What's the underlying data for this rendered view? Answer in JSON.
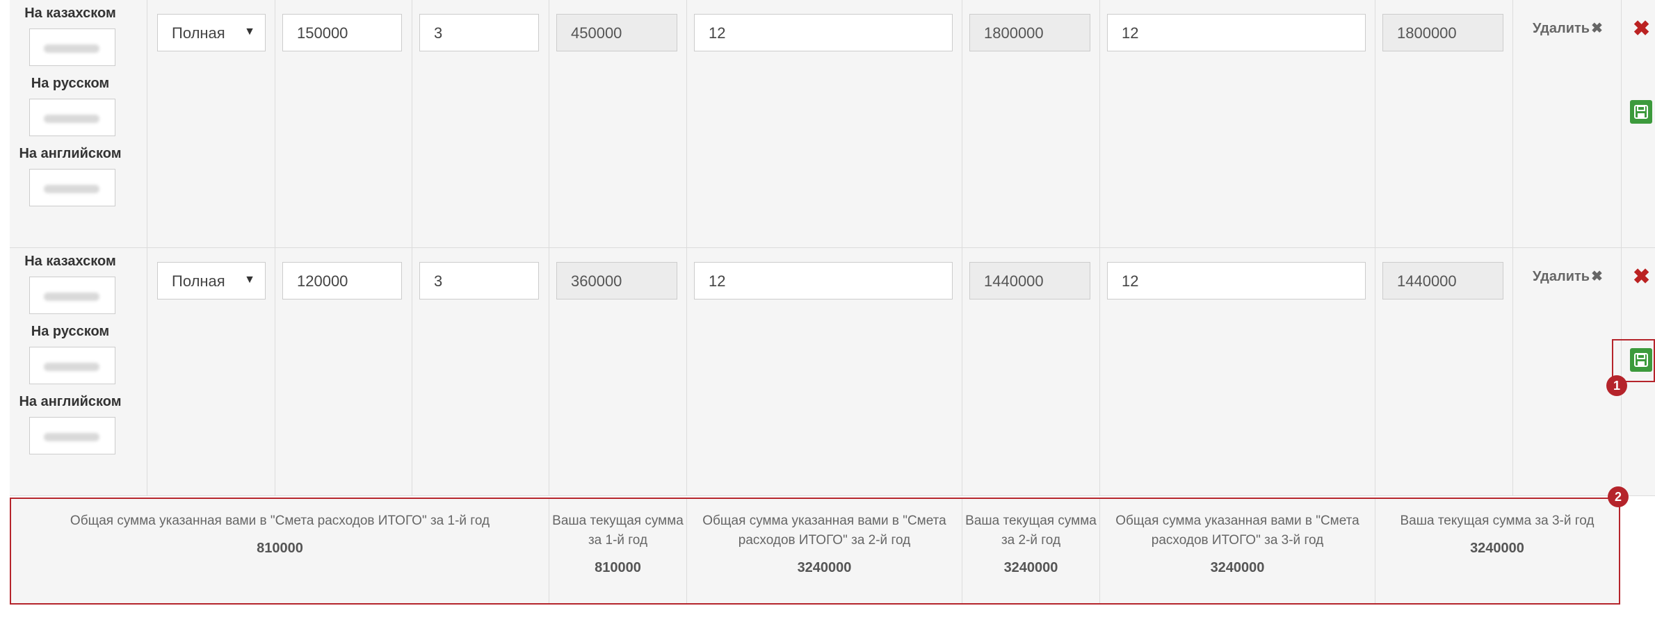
{
  "rows": [
    {
      "langs": [
        "На казахском",
        "На русском",
        "На английском"
      ],
      "type": "Полная",
      "price": "150000",
      "qty": "3",
      "total1": "450000",
      "months2": "12",
      "total2": "1800000",
      "months3": "12",
      "total3": "1800000",
      "delete_label": "Удалить",
      "delete_x": "✖"
    },
    {
      "langs": [
        "На казахском",
        "На русском",
        "На английском"
      ],
      "type": "Полная",
      "price": "120000",
      "qty": "3",
      "total1": "360000",
      "months2": "12",
      "total2": "1440000",
      "months3": "12",
      "total3": "1440000",
      "delete_label": "Удалить",
      "delete_x": "✖"
    }
  ],
  "icons": {
    "remove": "close-icon",
    "save": "floppy-disk-icon",
    "caret": "▼",
    "remove_glyph": "✖",
    "remove_color": "#b22222",
    "save_color": "#3c9a3c"
  },
  "badges": {
    "b1": "1",
    "b2": "2",
    "color": "#b5242b"
  },
  "summary": {
    "year1_declared_label": "Общая сумма указанная вами в \"Смета расходов ИТОГО\" за 1-й год",
    "year1_declared_value": "810000",
    "year1_current_label": "Ваша текущая сумма за 1-й год",
    "year1_current_value": "810000",
    "year2_declared_label": "Общая сумма указанная вами в \"Смета расходов ИТОГО\" за 2-й год",
    "year2_declared_value": "3240000",
    "year2_current_label": "Ваша текущая сумма за 2-й год",
    "year2_current_value": "3240000",
    "year3_declared_label": "Общая сумма указанная вами в \"Смета расходов ИТОГО\" за 3-й год",
    "year3_declared_value": "3240000",
    "year3_current_label": "Ваша текущая сумма за 3-й год",
    "year3_current_value": "3240000"
  }
}
